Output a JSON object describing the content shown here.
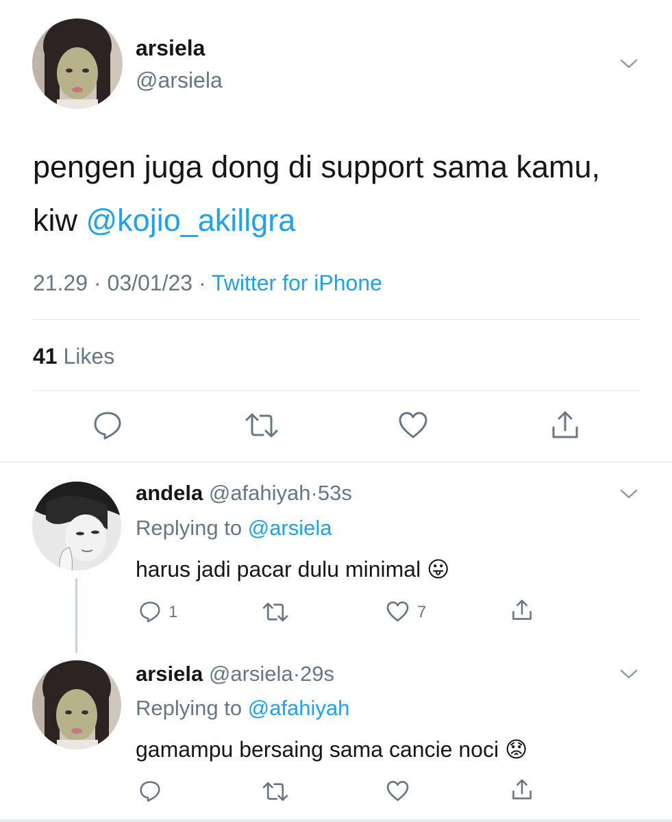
{
  "main_tweet": {
    "display_name": "arsiela",
    "handle": "@arsiela",
    "text_before": "pengen juga dong di support sama kamu, kiw ",
    "mention": "@kojio_akillgra",
    "time": "21.29",
    "date": "03/01/23",
    "separator": "·",
    "source": "Twitter for iPhone",
    "likes_count": "41",
    "likes_label": "Likes"
  },
  "replies": [
    {
      "display_name": "andela",
      "handle": "@afahiyah",
      "time": "53s",
      "replying_label": "Replying to",
      "replying_to": "@arsiela",
      "text": "harus jadi pacar dulu minimal",
      "emoji": "😛",
      "reply_count": "1",
      "like_count": "7"
    },
    {
      "display_name": "arsiela",
      "handle": "@arsiela",
      "time": "29s",
      "replying_label": "Replying to",
      "replying_to": "@afahiyah",
      "text": "gamampu bersaing sama cancie noci",
      "emoji": "😟",
      "reply_count": "",
      "like_count": ""
    }
  ],
  "colors": {
    "accent": "#1da1f2",
    "secondary_text": "#657786",
    "divider": "#e1e8ed"
  }
}
